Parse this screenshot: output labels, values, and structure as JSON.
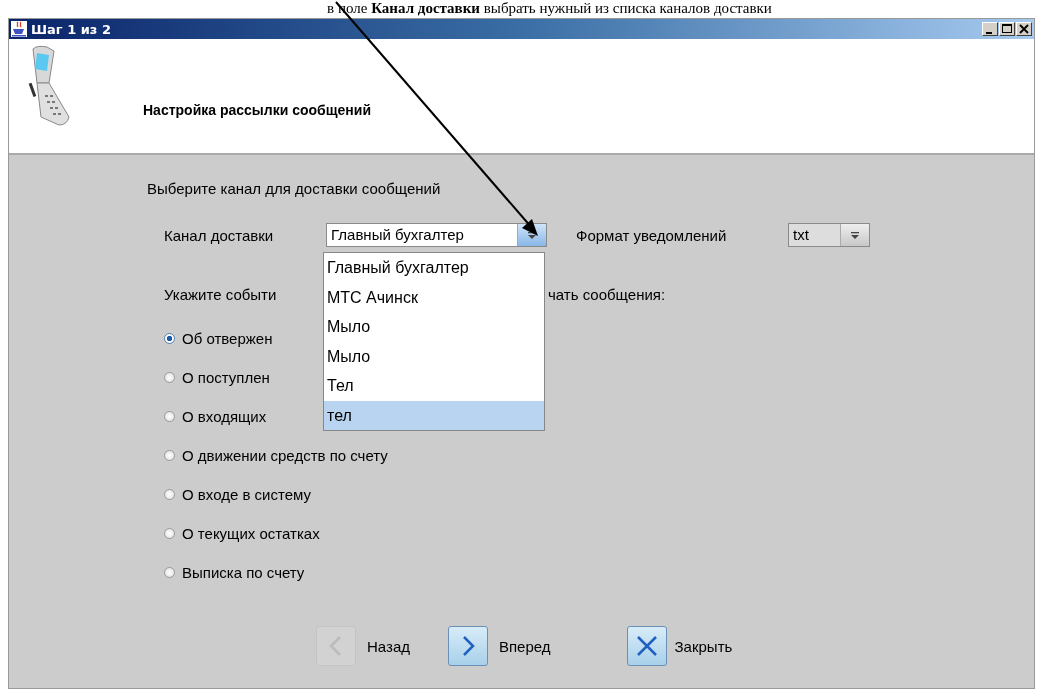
{
  "caption": "в поле **Канал доставки** выбрать нужный из списка каналов доставки",
  "window": {
    "title": "Шаг 1 из 2"
  },
  "header": {
    "title": "Настройка рассылки сообщений"
  },
  "channel_prompt": "Выберите канал для доставки сообщений",
  "channel": {
    "label": "Канал доставки",
    "value": "Главный бухгалтер",
    "focused": true
  },
  "format": {
    "label": "Формат уведомлений",
    "value": "txt",
    "focused": false
  },
  "channel_list": [
    {
      "label": "Главный бухгалтер",
      "selected": false
    },
    {
      "label": "МТС Ачинск",
      "selected": false
    },
    {
      "label": "Мыло",
      "selected": false
    },
    {
      "label": "Мыло",
      "selected": false
    },
    {
      "label": "Тел",
      "selected": false
    },
    {
      "label": "тел",
      "selected": true
    }
  ],
  "events_prompt": [
    "Укажите событи",
    "чать сообщения:"
  ],
  "events": [
    {
      "label": "Об отвержен",
      "selected": true
    },
    {
      "label": "О поступлен",
      "selected": false
    },
    {
      "label": "О входящих",
      "selected": false
    },
    {
      "label": "О движении средств по счету",
      "selected": false
    },
    {
      "label": "О входе в систему",
      "selected": false
    },
    {
      "label": "О текущих остатках",
      "selected": false
    },
    {
      "label": "Выписка по счету",
      "selected": false
    }
  ],
  "buttons": [
    {
      "kind": "back",
      "label": "Назад",
      "disabled": true
    },
    {
      "kind": "next",
      "label": "Вперед",
      "disabled": false
    },
    {
      "kind": "close",
      "label": "Закрыть",
      "disabled": false
    }
  ]
}
